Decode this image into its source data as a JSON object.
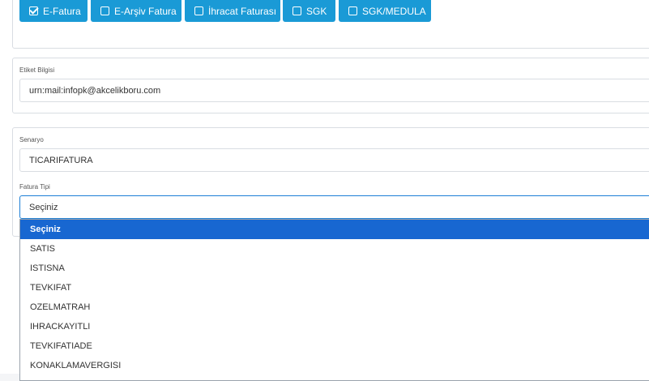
{
  "invoice_types": [
    {
      "label": "E-Fatura",
      "checked": true
    },
    {
      "label": "E-Arşiv Fatura",
      "checked": false
    },
    {
      "label": "İhracat Faturası",
      "checked": false
    },
    {
      "label": "SGK",
      "checked": false
    },
    {
      "label": "SGK/MEDULA",
      "checked": false
    }
  ],
  "label_info": {
    "label": "Etiket Bilgisi",
    "value": "urn:mail:infopk@akcelikboru.com"
  },
  "scenario": {
    "label": "Senaryo",
    "value": "TICARIFATURA"
  },
  "invoice_kind": {
    "label": "Fatura Tipi",
    "value": "Seçiniz",
    "options": [
      "Seçiniz",
      "SATIS",
      "ISTISNA",
      "TEVKIFAT",
      "OZELMATRAH",
      "IHRACKAYITLI",
      "TEVKIFATIADE",
      "KONAKLAMAVERGISI"
    ],
    "highlighted_index": 0
  },
  "colors": {
    "button_blue": "#1a9ad6",
    "highlight_blue": "#1867d1",
    "focus_border": "#1d7fd6"
  }
}
